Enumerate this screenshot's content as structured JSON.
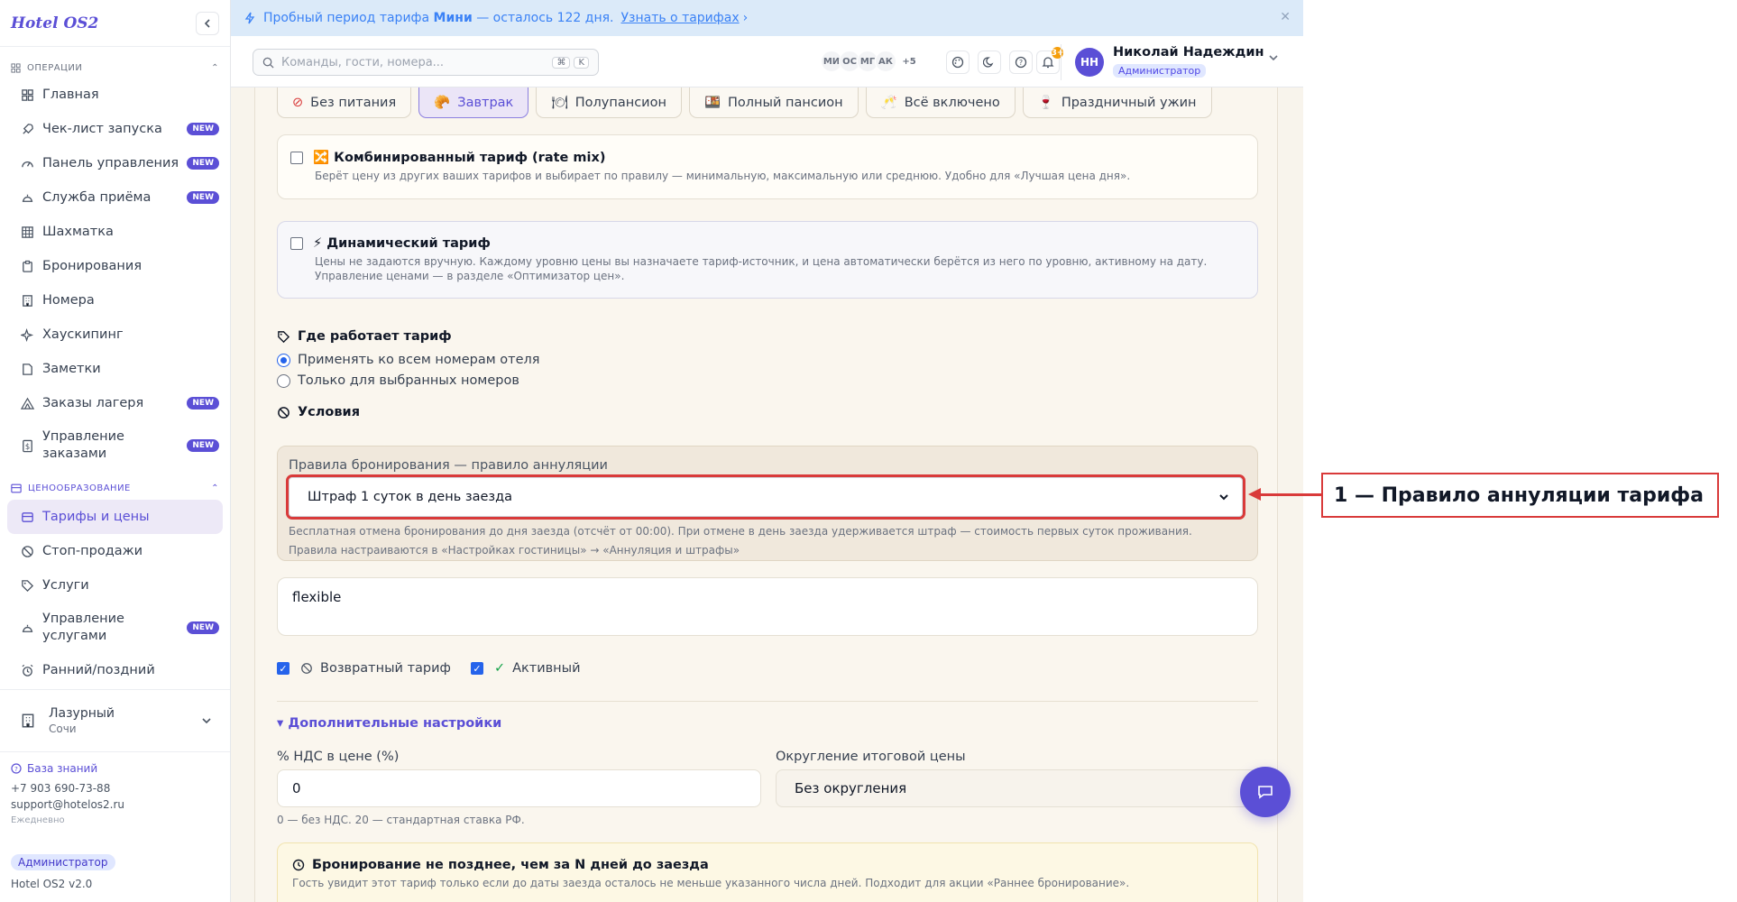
{
  "app": {
    "title": "Hotel OS2"
  },
  "sidebar": {
    "sections": [
      {
        "label": "ОПЕРАЦИИ"
      },
      {
        "label": "ЦЕНООБРАЗОВАНИЕ"
      }
    ],
    "ops_items": [
      {
        "label": "Главная",
        "icon": "grid-icon"
      },
      {
        "label": "Чек-лист запуска",
        "icon": "rocket-icon",
        "badge": "NEW"
      },
      {
        "label": "Панель управления",
        "icon": "gauge-icon",
        "badge": "NEW"
      },
      {
        "label": "Служба приёма",
        "icon": "bell-service-icon",
        "badge": "NEW"
      },
      {
        "label": "Шахматка",
        "icon": "table-grid-icon"
      },
      {
        "label": "Бронирования",
        "icon": "clipboard-icon"
      },
      {
        "label": "Номера",
        "icon": "building-icon"
      },
      {
        "label": "Хаускипинг",
        "icon": "sparkles-icon"
      },
      {
        "label": "Заметки",
        "icon": "note-icon"
      },
      {
        "label": "Заказы лагеря",
        "icon": "tent-icon",
        "badge": "NEW"
      },
      {
        "label": "Управление заказами",
        "icon": "dollar-doc-icon",
        "badge": "NEW"
      }
    ],
    "pricing_items": [
      {
        "label": "Тарифы и цены",
        "icon": "card-icon",
        "active": true
      },
      {
        "label": "Стоп-продажи",
        "icon": "ban-icon"
      },
      {
        "label": "Услуги",
        "icon": "tag-icon"
      },
      {
        "label": "Управление услугами",
        "icon": "bell-service-icon",
        "badge": "NEW"
      },
      {
        "label": "Ранний/поздний",
        "icon": "alarm-icon"
      }
    ],
    "hotel": {
      "name": "Лазурный",
      "city": "Сочи"
    },
    "footer": {
      "kb": "База знаний",
      "phone": "+7 903 690-73-88",
      "email": "support@hotelos2.ru",
      "hours": "Ежедневно",
      "role": "Администратор",
      "version": "Hotel OS2 v2.0"
    }
  },
  "banner": {
    "prefix": "Пробный период тарифа",
    "plan": "Мини",
    "suffix": "— осталось 122 дня.",
    "link": "Узнать о тарифах"
  },
  "topbar": {
    "search_placeholder": "Команды, гости, номера...",
    "kbd1": "⌘",
    "kbd2": "K",
    "users": [
      "МИ",
      "ОС",
      "МГ",
      "АК"
    ],
    "users_more": "+5",
    "notif_count": "3+",
    "user_name": "Николай Надеждин",
    "user_initials": "НН",
    "user_role": "Администратор"
  },
  "meal_plans": [
    {
      "label": "Без питания",
      "icon": "ban-icon"
    },
    {
      "label": "Завтрак",
      "icon": "croissant-icon",
      "active": true
    },
    {
      "label": "Полупансион",
      "icon": "plate-icon"
    },
    {
      "label": "Полный пансион",
      "icon": "food-box-icon"
    },
    {
      "label": "Всё включено",
      "icon": "party-icon"
    },
    {
      "label": "Праздничный ужин",
      "icon": "wine-icon"
    }
  ],
  "rate_mix": {
    "title": "🔀 Комбинированный тариф (rate mix)",
    "desc": "Берёт цену из других ваших тарифов и выбирает по правилу — минимальную, максимальную или среднюю. Удобно для «Лучшая цена дня»."
  },
  "dynamic": {
    "title": "⚡ Динамический тариф",
    "desc": "Цены не задаются вручную. Каждому уровню цены вы назначаете тариф-источник, и цена автоматически берётся из него по уровню, активному на дату. Управление ценами — в разделе «Оптимизатор цен»."
  },
  "scope": {
    "title": "Где работает тариф",
    "opt_all": "Применять ко всем номерам отеля",
    "opt_selected": "Только для выбранных номеров"
  },
  "conditions": {
    "title": "Условия",
    "rules_label": "Правила бронирования — правило аннуляции",
    "rules_value": "Штраф 1 суток в день заезда",
    "rules_help1": "Бесплатная отмена бронирования до дня заезда (отсчёт от 00:00). При отмене в день заезда удерживается штраф — стоимость первых суток проживания.",
    "rules_help2": "Правила настраиваются в «Настройках гостиницы» → «Аннуляция и штрафы»",
    "code_value": "flexible",
    "refundable": "Возвратный тариф",
    "active": "Активный"
  },
  "advanced": {
    "toggle": "▾ Дополнительные настройки",
    "vat_label": "% НДС в цене (%)",
    "vat_value": "0",
    "vat_help": "0 — без НДС. 20 — стандартная ставка РФ.",
    "round_label": "Округление итоговой цены",
    "round_value": "Без округления"
  },
  "early": {
    "title": "Бронирование не позднее, чем за N дней до заезда",
    "desc": "Гость увидит этот тариф только если до даты заезда осталось не меньше указанного числа дней. Подходит для акции «Раннее бронирование»."
  },
  "annotation": {
    "text": "1 — Правило аннуляции тарифа"
  },
  "colors": {
    "accent": "#5b4fd6",
    "annotation": "#d93a3a",
    "checkbox": "#2563eb"
  }
}
